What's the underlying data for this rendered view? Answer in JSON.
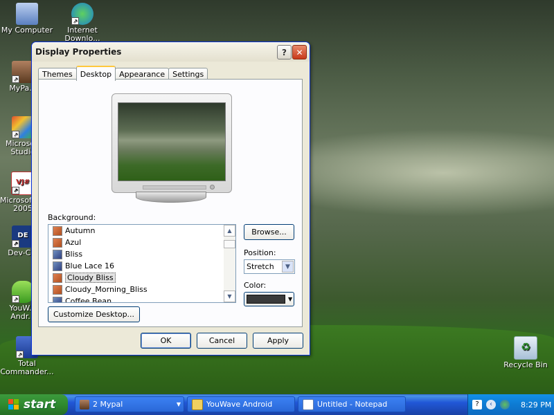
{
  "desktop": {
    "icons": [
      {
        "label": "My Computer"
      },
      {
        "label": "Internet Downlo..."
      },
      {
        "label": "MyPa..."
      },
      {
        "label": "Microsoft Studio"
      },
      {
        "label": "Microsoft J# 2005"
      },
      {
        "label": "Dev-C..."
      },
      {
        "label": "YouW... Andr..."
      },
      {
        "label": "Total Commander..."
      },
      {
        "label": "Recycle Bin"
      }
    ]
  },
  "dialog": {
    "title": "Display Properties",
    "help_glyph": "?",
    "close_glyph": "✕",
    "tabs": [
      "Themes",
      "Desktop",
      "Appearance",
      "Settings"
    ],
    "active_tab": "Desktop",
    "background_label": "Background:",
    "backgrounds": [
      {
        "name": "Autumn",
        "icon": "jpg"
      },
      {
        "name": "Azul",
        "icon": "jpg"
      },
      {
        "name": "Bliss",
        "icon": "bmp"
      },
      {
        "name": "Blue Lace 16",
        "icon": "bmp"
      },
      {
        "name": "Cloudy Bliss",
        "icon": "jpg"
      },
      {
        "name": "Cloudy_Morning_Bliss",
        "icon": "jpg"
      },
      {
        "name": "Coffee Bean",
        "icon": "bmp"
      }
    ],
    "selected_background": "Cloudy Bliss",
    "browse_label": "Browse...",
    "position_label": "Position:",
    "position_value": "Stretch",
    "color_label": "Color:",
    "color_value": "#3a3a3a",
    "customize_label": "Customize Desktop...",
    "ok_label": "OK",
    "cancel_label": "Cancel",
    "apply_label": "Apply"
  },
  "taskbar": {
    "start_label": "start",
    "tasks": [
      {
        "label": "2 Mypal"
      },
      {
        "label": "YouWave Android"
      },
      {
        "label": "Untitled - Notepad"
      }
    ],
    "clock": "8:29 PM"
  }
}
